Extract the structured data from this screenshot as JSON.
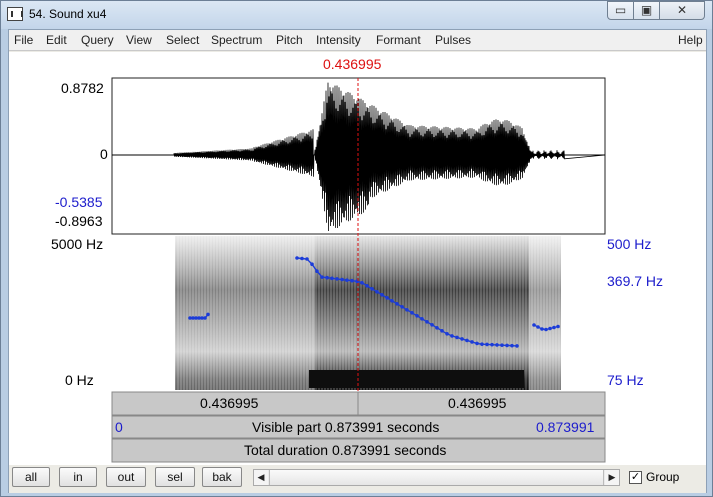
{
  "window": {
    "title": "54. Sound xu4",
    "min_glyph": "▭",
    "max_glyph": "▣",
    "close_glyph": "✕"
  },
  "menu": {
    "items": [
      "File",
      "Edit",
      "Query",
      "View",
      "Select",
      "Spectrum",
      "Pitch",
      "Intensity",
      "Formant",
      "Pulses"
    ],
    "help": "Help"
  },
  "cursor": {
    "time_label": "0.436995"
  },
  "waveform": {
    "y_max": "0.8782",
    "y_zero": "0",
    "y_local_min_blue": "-0.5385",
    "y_min": "-0.8963"
  },
  "spectrogram": {
    "freq_top": "5000 Hz",
    "freq_bottom": "0 Hz",
    "pitch_top": "500 Hz",
    "pitch_value": "369.7 Hz",
    "pitch_bottom": "75 Hz"
  },
  "time_bar": {
    "left_segment": "0.436995",
    "right_segment": "0.436995",
    "visible_start": "0",
    "visible_label": "Visible part 0.873991 seconds",
    "visible_end": "0.873991",
    "total_label": "Total duration 0.873991 seconds"
  },
  "bottom": {
    "buttons": [
      "all",
      "in",
      "out",
      "sel",
      "bak"
    ],
    "group_label": "Group",
    "group_checked": true
  },
  "colors": {
    "pitch_track": "#1c3cd8",
    "cursor": "#dd1111",
    "axis_blue": "#1c1ccc"
  }
}
